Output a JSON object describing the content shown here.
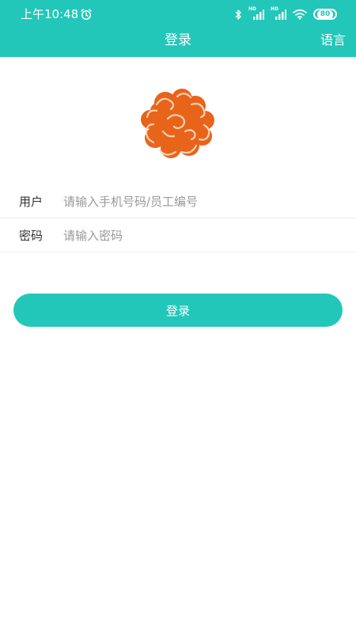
{
  "status_bar": {
    "time": "上午10:48",
    "battery": "80",
    "network_label_1": "HD",
    "network_label_2": "HD"
  },
  "app_bar": {
    "title": "登录",
    "language_label": "语言"
  },
  "logo": {
    "icon": "cloud-logo-icon",
    "color": "#e8641a"
  },
  "form": {
    "username": {
      "label": "用户",
      "placeholder": "请输入手机号码/员工编号",
      "value": ""
    },
    "password": {
      "label": "密码",
      "placeholder": "请输入密码",
      "value": ""
    },
    "submit_label": "登录"
  },
  "colors": {
    "accent": "#22c7b9",
    "logo": "#e8641a",
    "divider": "#ececec"
  }
}
